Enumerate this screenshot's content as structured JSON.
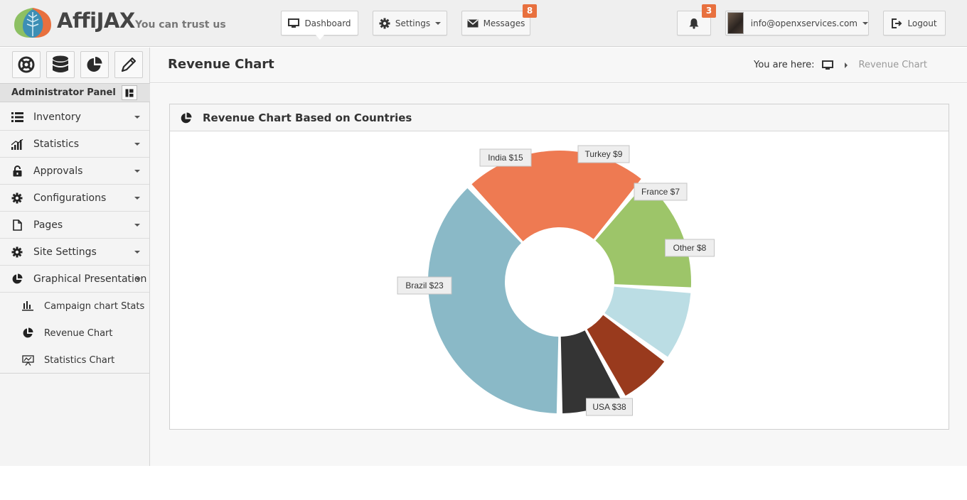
{
  "brand": {
    "name": "AffiJAX",
    "tagline": "You can trust us"
  },
  "topnav": {
    "dashboard": "Dashboard",
    "settings": "Settings",
    "messages": "Messages",
    "messages_count": "8",
    "notifications_count": "3",
    "user_email": "info@openxservices.com",
    "logout": "Logout"
  },
  "sidebar": {
    "panel_title": "Administrator Panel",
    "items": [
      {
        "label": "Inventory",
        "icon": "list-icon"
      },
      {
        "label": "Statistics",
        "icon": "signal-bars-icon"
      },
      {
        "label": "Approvals",
        "icon": "unlock-icon"
      },
      {
        "label": "Configurations",
        "icon": "gear-icon"
      },
      {
        "label": "Pages",
        "icon": "file-icon"
      },
      {
        "label": "Site Settings",
        "icon": "gear-icon"
      },
      {
        "label": "Graphical Presentation",
        "icon": "pie-chart-icon"
      }
    ],
    "subitems": [
      {
        "label": "Campaign chart Stats",
        "icon": "bar-chart-icon"
      },
      {
        "label": "Revenue Chart",
        "icon": "pie-chart-icon"
      },
      {
        "label": "Statistics Chart",
        "icon": "presentation-chart-icon"
      }
    ]
  },
  "page": {
    "title": "Revenue Chart",
    "breadcrumb_prefix": "You are here:",
    "breadcrumb_current": "Revenue Chart"
  },
  "widget": {
    "title": "Revenue Chart Based on Countries"
  },
  "chart_data": {
    "type": "pie",
    "style": "donut",
    "categories": [
      "USA",
      "Brazil",
      "India",
      "Turkey",
      "France",
      "Other"
    ],
    "values": [
      38,
      23,
      15,
      9,
      7,
      8
    ],
    "labels": [
      "USA $38",
      "Brazil $23",
      "India $15",
      "Turkey $9",
      "France $7",
      "Other $8"
    ],
    "colors": [
      "#8ab9c7",
      "#ee7a52",
      "#9dc569",
      "#bbdde4",
      "#993a1d",
      "#343434"
    ]
  }
}
